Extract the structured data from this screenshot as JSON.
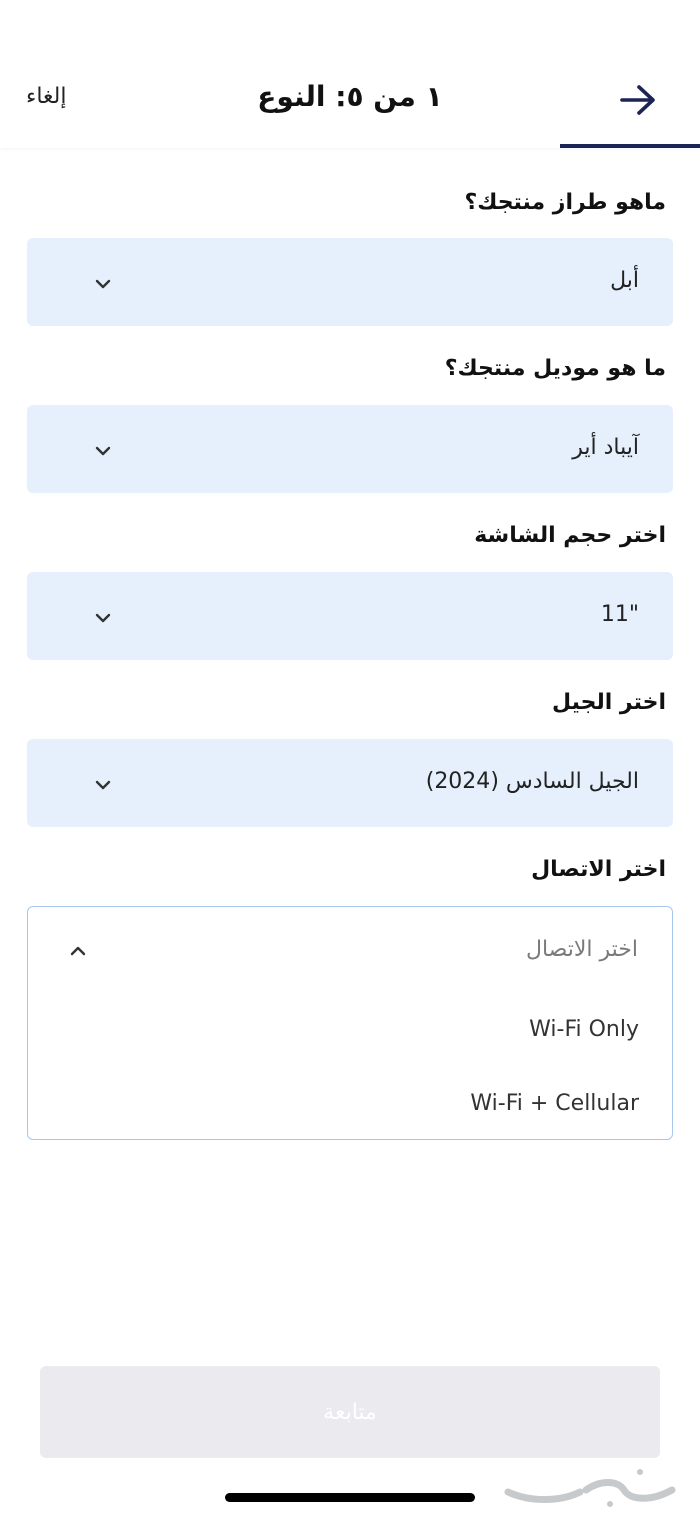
{
  "header": {
    "cancel_label": "إلغاء",
    "title": "١ من ٥: النوع",
    "back_icon": "arrow-right-icon",
    "accent_color": "#1b2455"
  },
  "questions": [
    {
      "label": "ماهو طراز منتجك؟",
      "value": "أبل"
    },
    {
      "label": "ما هو موديل منتجك؟",
      "value": "آيباد أير"
    },
    {
      "label": "اختر حجم الشاشة",
      "value": "\"11"
    },
    {
      "label": "اختر الجيل",
      "value": "الجيل السادس (2024)"
    },
    {
      "label": "اختر الاتصال",
      "placeholder": "اختر الاتصال"
    }
  ],
  "connection_options": [
    "Wi-Fi Only",
    "Wi-Fi + Cellular"
  ],
  "continue_label": "متابعة",
  "colors": {
    "select_bg": "#e5f0fc",
    "dropdown_border": "#a8c8ec",
    "disabled_button": "#eaeaef"
  }
}
